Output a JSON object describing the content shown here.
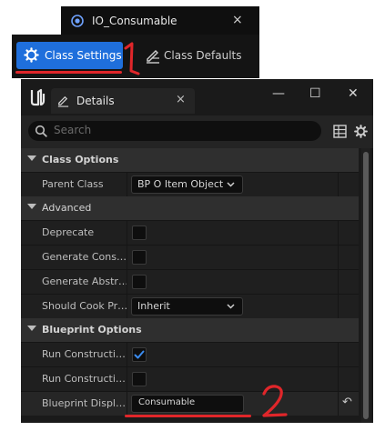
{
  "asset_tab": {
    "title": "IO_Consumable",
    "close": "×"
  },
  "toolbar": {
    "class_settings": "Class Settings",
    "class_defaults": "Class Defaults"
  },
  "annotations": {
    "one": "1",
    "two": "2"
  },
  "details": {
    "tab_label": "Details",
    "tab_close": "×",
    "window_buttons": {
      "minimize": "—",
      "maximize": "☐",
      "close": "✕"
    },
    "search_placeholder": "Search",
    "categories": [
      {
        "label": "Class Options"
      },
      {
        "label": "Advanced"
      },
      {
        "label": "Blueprint Options"
      }
    ],
    "properties": {
      "parent_class": {
        "name": "Parent Class",
        "value": "BP O Item Object"
      },
      "deprecate": {
        "name": "Deprecate",
        "checked": false
      },
      "generate_cons": {
        "name": "Generate Cons…",
        "checked": false
      },
      "generate_abstr": {
        "name": "Generate Abstr…",
        "checked": false
      },
      "should_cook": {
        "name": "Should Cook Pr…",
        "value": "Inherit"
      },
      "run_construction_1": {
        "name": "Run Constructi…",
        "checked": true
      },
      "run_construction_2": {
        "name": "Run Constructi…",
        "checked": false
      },
      "blueprint_display": {
        "name": "Blueprint Displ…",
        "value": "Consumable",
        "reset": "↶"
      }
    }
  },
  "colors": {
    "accent_blue": "#1f6fdc",
    "annotation_red": "#e0262a",
    "check_blue": "#3b8cf0"
  }
}
